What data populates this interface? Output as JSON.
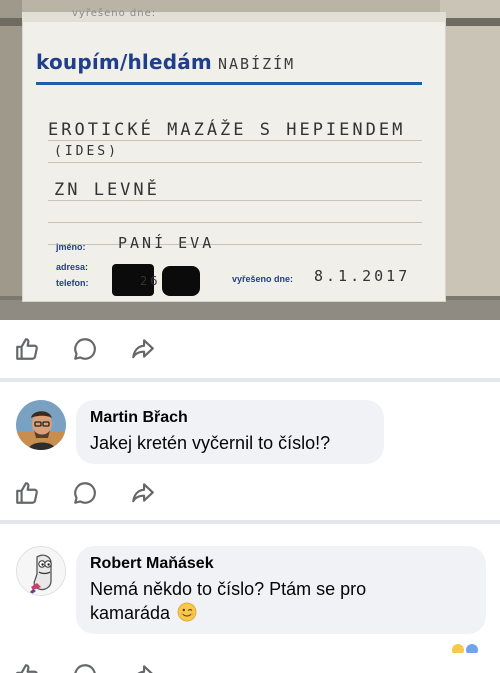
{
  "post": {
    "photo": {
      "top_strip_text": "vyřešeno dne:",
      "heading_main": "koupím/hledám",
      "heading_alt": "NABÍZÍM",
      "line1": "EROTICKÉ MAZÁŽE S HEPIENDEM",
      "line2": "(IDES)",
      "line3": "ZN LEVNĚ",
      "label_jmeno": "jméno:",
      "value_jmeno": "PANÍ EVA",
      "label_adresa": "adresa:",
      "label_telefon": "telefon:",
      "value_telefon_partial": "26",
      "label_vyreseno": "vyřešeno dne:",
      "value_vyreseno": "8.1.2017"
    }
  },
  "actions": {
    "like_icon": "thumbs-up-outline-icon",
    "comment_icon": "speech-bubble-outline-icon",
    "share_icon": "share-arrow-outline-icon"
  },
  "comments": [
    {
      "author": "Martin Břach",
      "text": "Jakej kretén vyčernil to číslo!?",
      "avatar_icon": "user-photo-avatar"
    },
    {
      "author": "Robert Maňásek",
      "text_line1": "Nemá někdo to číslo? Ptám se pro",
      "text_line2": "kamaráda",
      "emoji": "winking-smile-emoji",
      "avatar_icon": "cartoon-sock-puppet-avatar"
    }
  ],
  "colors": {
    "facebook_gray": "#65676b",
    "bubble_bg": "#f0f2f5",
    "heading_blue": "#1f3f8a"
  }
}
